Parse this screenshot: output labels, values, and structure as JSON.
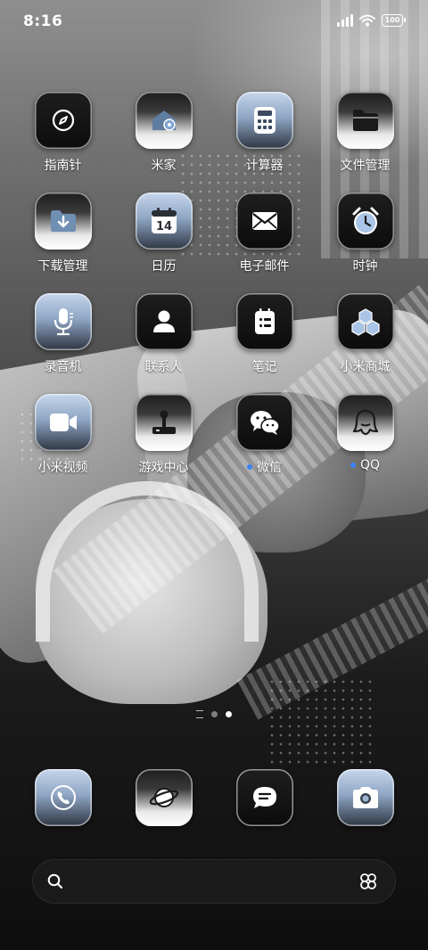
{
  "status_bar": {
    "time": "8:16",
    "battery_level": "100",
    "icons": [
      "cellular-signal-icon",
      "wifi-icon",
      "battery-icon"
    ]
  },
  "home_grid": [
    {
      "label": "指南针",
      "icon": "compass-icon",
      "style": "dark",
      "notification": false
    },
    {
      "label": "米家",
      "icon": "home-icon",
      "style": "silver",
      "notification": false
    },
    {
      "label": "计算器",
      "icon": "calculator-icon",
      "style": "blue",
      "notification": false
    },
    {
      "label": "文件管理",
      "icon": "folder-icon",
      "style": "silver",
      "notification": false
    },
    {
      "label": "下载管理",
      "icon": "download-folder-icon",
      "style": "silver",
      "notification": false
    },
    {
      "label": "日历",
      "icon": "calendar-icon",
      "style": "blue",
      "notification": false,
      "icon_text": "14"
    },
    {
      "label": "电子邮件",
      "icon": "mail-icon",
      "style": "dark",
      "notification": false
    },
    {
      "label": "时钟",
      "icon": "alarm-clock-icon",
      "style": "dark",
      "notification": false
    },
    {
      "label": "录音机",
      "icon": "microphone-icon",
      "style": "blue",
      "notification": false
    },
    {
      "label": "联系人",
      "icon": "person-icon",
      "style": "dark",
      "notification": false
    },
    {
      "label": "笔记",
      "icon": "notes-icon",
      "style": "dark",
      "notification": false
    },
    {
      "label": "小米商城",
      "icon": "store-cubes-icon",
      "style": "dark",
      "notification": false
    },
    {
      "label": "小米视频",
      "icon": "video-camera-icon",
      "style": "blue",
      "notification": false
    },
    {
      "label": "游戏中心",
      "icon": "joystick-icon",
      "style": "silver",
      "notification": false
    },
    {
      "label": "微信",
      "icon": "wechat-icon",
      "style": "dark",
      "notification": true
    },
    {
      "label": "QQ",
      "icon": "qq-penguin-icon",
      "style": "silver",
      "notification": true
    }
  ],
  "page_indicator": {
    "pages": 2,
    "active_page": 2
  },
  "dock": [
    {
      "name": "phone",
      "icon": "phone-icon",
      "style": "blue"
    },
    {
      "name": "browser",
      "icon": "planet-icon",
      "style": "silver"
    },
    {
      "name": "messages",
      "icon": "message-bubble-icon",
      "style": "dark"
    },
    {
      "name": "camera",
      "icon": "camera-icon",
      "style": "blue"
    }
  ],
  "search": {
    "placeholder": "",
    "icons": [
      "search-icon",
      "app-launcher-icon"
    ]
  },
  "colors": {
    "notification_dot": "#3b82f6",
    "text": "#ffffff"
  }
}
